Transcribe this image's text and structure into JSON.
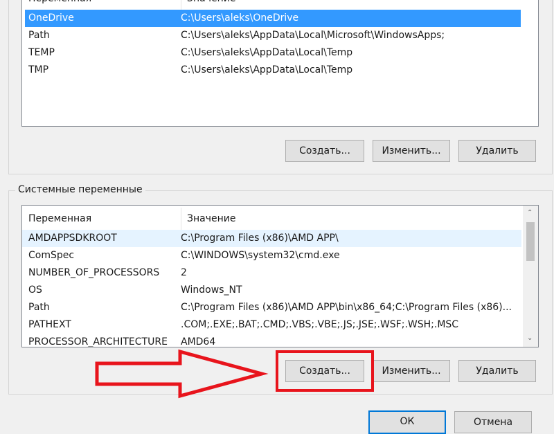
{
  "user_vars": {
    "header_var": "Переменная",
    "header_val": "Значение",
    "rows": [
      {
        "name": "OneDrive",
        "value": "C:\\Users\\aleks\\OneDrive"
      },
      {
        "name": "Path",
        "value": "C:\\Users\\aleks\\AppData\\Local\\Microsoft\\WindowsApps;"
      },
      {
        "name": "TEMP",
        "value": "C:\\Users\\aleks\\AppData\\Local\\Temp"
      },
      {
        "name": "TMP",
        "value": "C:\\Users\\aleks\\AppData\\Local\\Temp"
      }
    ],
    "buttons": {
      "create": "Создать...",
      "edit": "Изменить...",
      "delete": "Удалить"
    }
  },
  "system_vars": {
    "group_title": "Системные переменные",
    "header_var": "Переменная",
    "header_val": "Значение",
    "rows": [
      {
        "name": "AMDAPPSDKROOT",
        "value": "C:\\Program Files (x86)\\AMD APP\\"
      },
      {
        "name": "ComSpec",
        "value": "C:\\WINDOWS\\system32\\cmd.exe"
      },
      {
        "name": "NUMBER_OF_PROCESSORS",
        "value": "2"
      },
      {
        "name": "OS",
        "value": "Windows_NT"
      },
      {
        "name": "Path",
        "value": "C:\\Program Files (x86)\\AMD APP\\bin\\x86_64;C:\\Program Files (x86)..."
      },
      {
        "name": "PATHEXT",
        "value": ".COM;.EXE;.BAT;.CMD;.VBS;.VBE;.JS;.JSE;.WSF;.WSH;.MSC"
      },
      {
        "name": "PROCESSOR_ARCHITECTURE",
        "value": "AMD64"
      }
    ],
    "buttons": {
      "create": "Создать...",
      "edit": "Изменить...",
      "delete": "Удалить"
    }
  },
  "dialog_buttons": {
    "ok": "ОК",
    "cancel": "Отмена"
  },
  "annotation": {
    "highlight_color": "#e8141c"
  },
  "colors": {
    "selection": "#3399ff",
    "default_button_border": "#0078d7"
  }
}
